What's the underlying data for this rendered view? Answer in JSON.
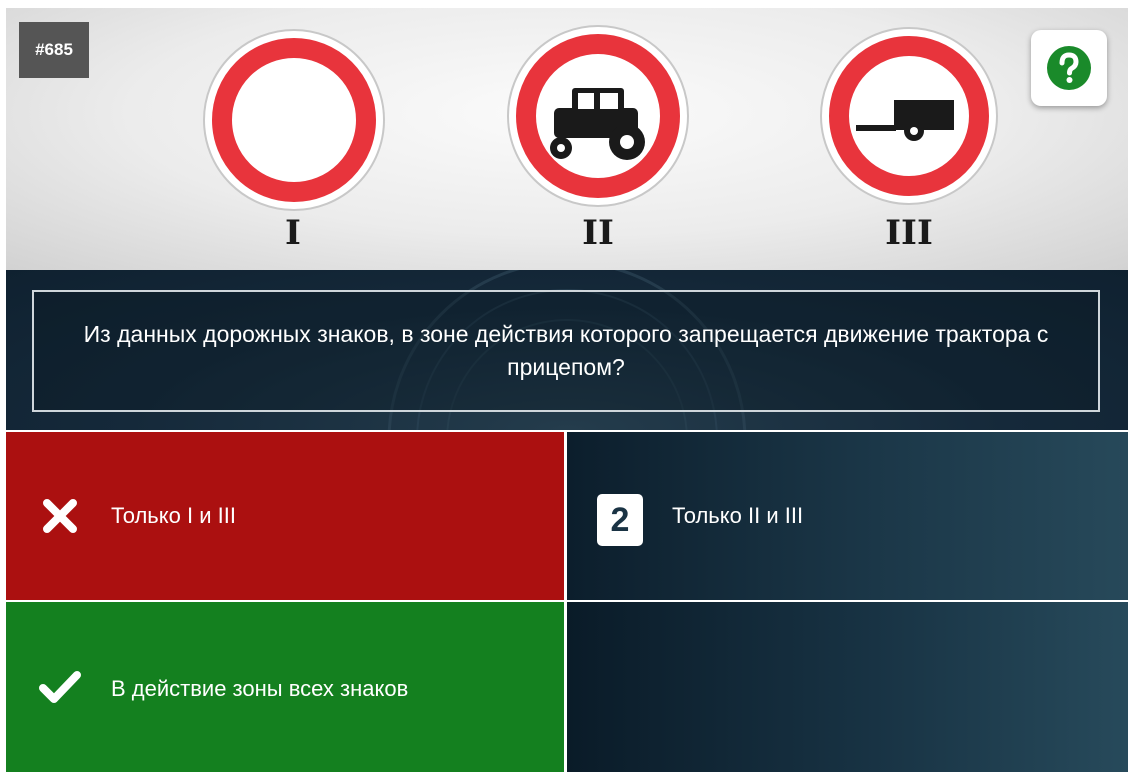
{
  "question": {
    "number": "#685",
    "text": "Из данных дорожных знаков, в зоне действия которого запрещается движение трактора с прицепом?"
  },
  "signs": [
    {
      "label": "I",
      "icon": "no-vehicles-sign"
    },
    {
      "label": "II",
      "icon": "no-tractors-sign"
    },
    {
      "label": "III",
      "icon": "no-trailer-sign"
    }
  ],
  "help": {
    "icon": "question-mark-icon",
    "color": "#1a8a2a"
  },
  "answers": [
    {
      "state": "wrong",
      "marker_icon": "cross-icon",
      "text": "Только I и III",
      "color": "#ab1010"
    },
    {
      "state": "neutral",
      "marker": "2",
      "text": "Только II и III",
      "color": "#1b3748"
    },
    {
      "state": "correct",
      "marker_icon": "check-icon",
      "text": "В действие зоны всех знаков",
      "color": "#14801f"
    }
  ],
  "colors": {
    "sign_red": "#e8343c",
    "sign_black": "#1a1a1a",
    "question_bg": "#15293a"
  }
}
